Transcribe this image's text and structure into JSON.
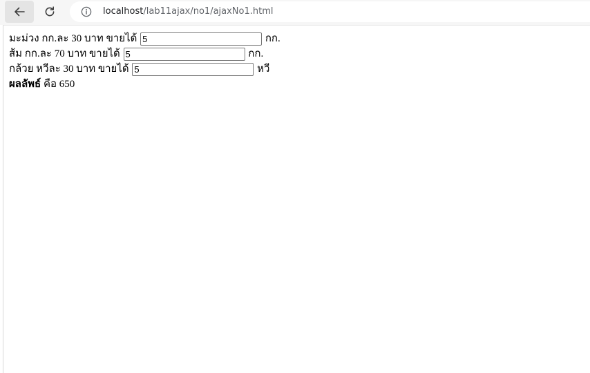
{
  "browser": {
    "url_host": "localhost",
    "url_path": "/lab11ajax/no1/ajaxNo1.html",
    "icons": {
      "back": "arrow-left-icon",
      "reload": "reload-icon",
      "site_info": "info-icon"
    }
  },
  "form": {
    "rows": [
      {
        "label": "มะม่วง กก.ละ 30 บาท ขายได้",
        "value": "5",
        "unit": "กก."
      },
      {
        "label": "ส้ม กก.ละ 70 บาท ขายได้",
        "value": "5",
        "unit": "กก."
      },
      {
        "label": "กล้วย หวีละ 30 บาท ขายได้",
        "value": "5",
        "unit": "หวี"
      }
    ],
    "total": {
      "label": "ผลลัพธ์",
      "text": "คือ 650"
    }
  }
}
